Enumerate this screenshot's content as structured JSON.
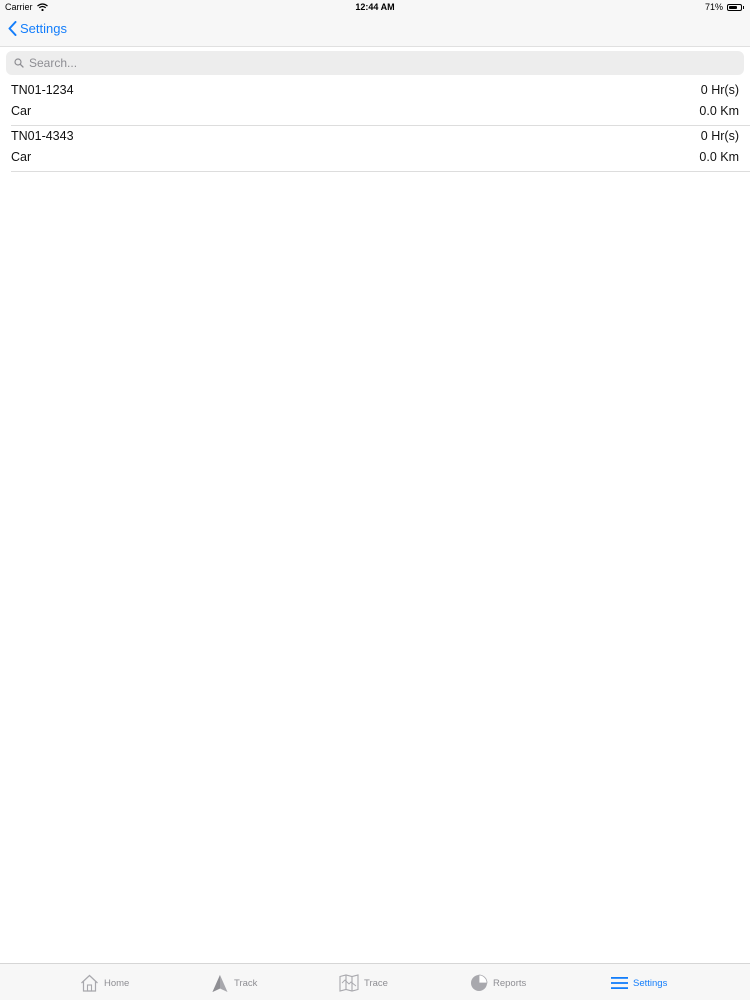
{
  "status_bar": {
    "carrier": "Carrier",
    "time": "12:44 AM",
    "battery": "71%",
    "battery_level": 0.71
  },
  "nav": {
    "back_label": "Settings"
  },
  "search": {
    "placeholder": "Search..."
  },
  "vehicles": [
    {
      "plate": "TN01-1234",
      "duration": "0 Hr(s)",
      "type": "Car",
      "distance": "0.0 Km"
    },
    {
      "plate": "TN01-4343",
      "duration": "0 Hr(s)",
      "type": "Car",
      "distance": "0.0 Km"
    }
  ],
  "tabs": [
    {
      "label": "Home",
      "icon": "home-icon"
    },
    {
      "label": "Track",
      "icon": "navigation-arrow-icon"
    },
    {
      "label": "Trace",
      "icon": "map-icon"
    },
    {
      "label": "Reports",
      "icon": "pie-chart-icon"
    },
    {
      "label": "Settings",
      "icon": "menu-lines-icon",
      "active": true
    }
  ],
  "colors": {
    "accent": "#147efb",
    "inactive": "#8e8e93",
    "bar_background": "#f7f7f7"
  }
}
